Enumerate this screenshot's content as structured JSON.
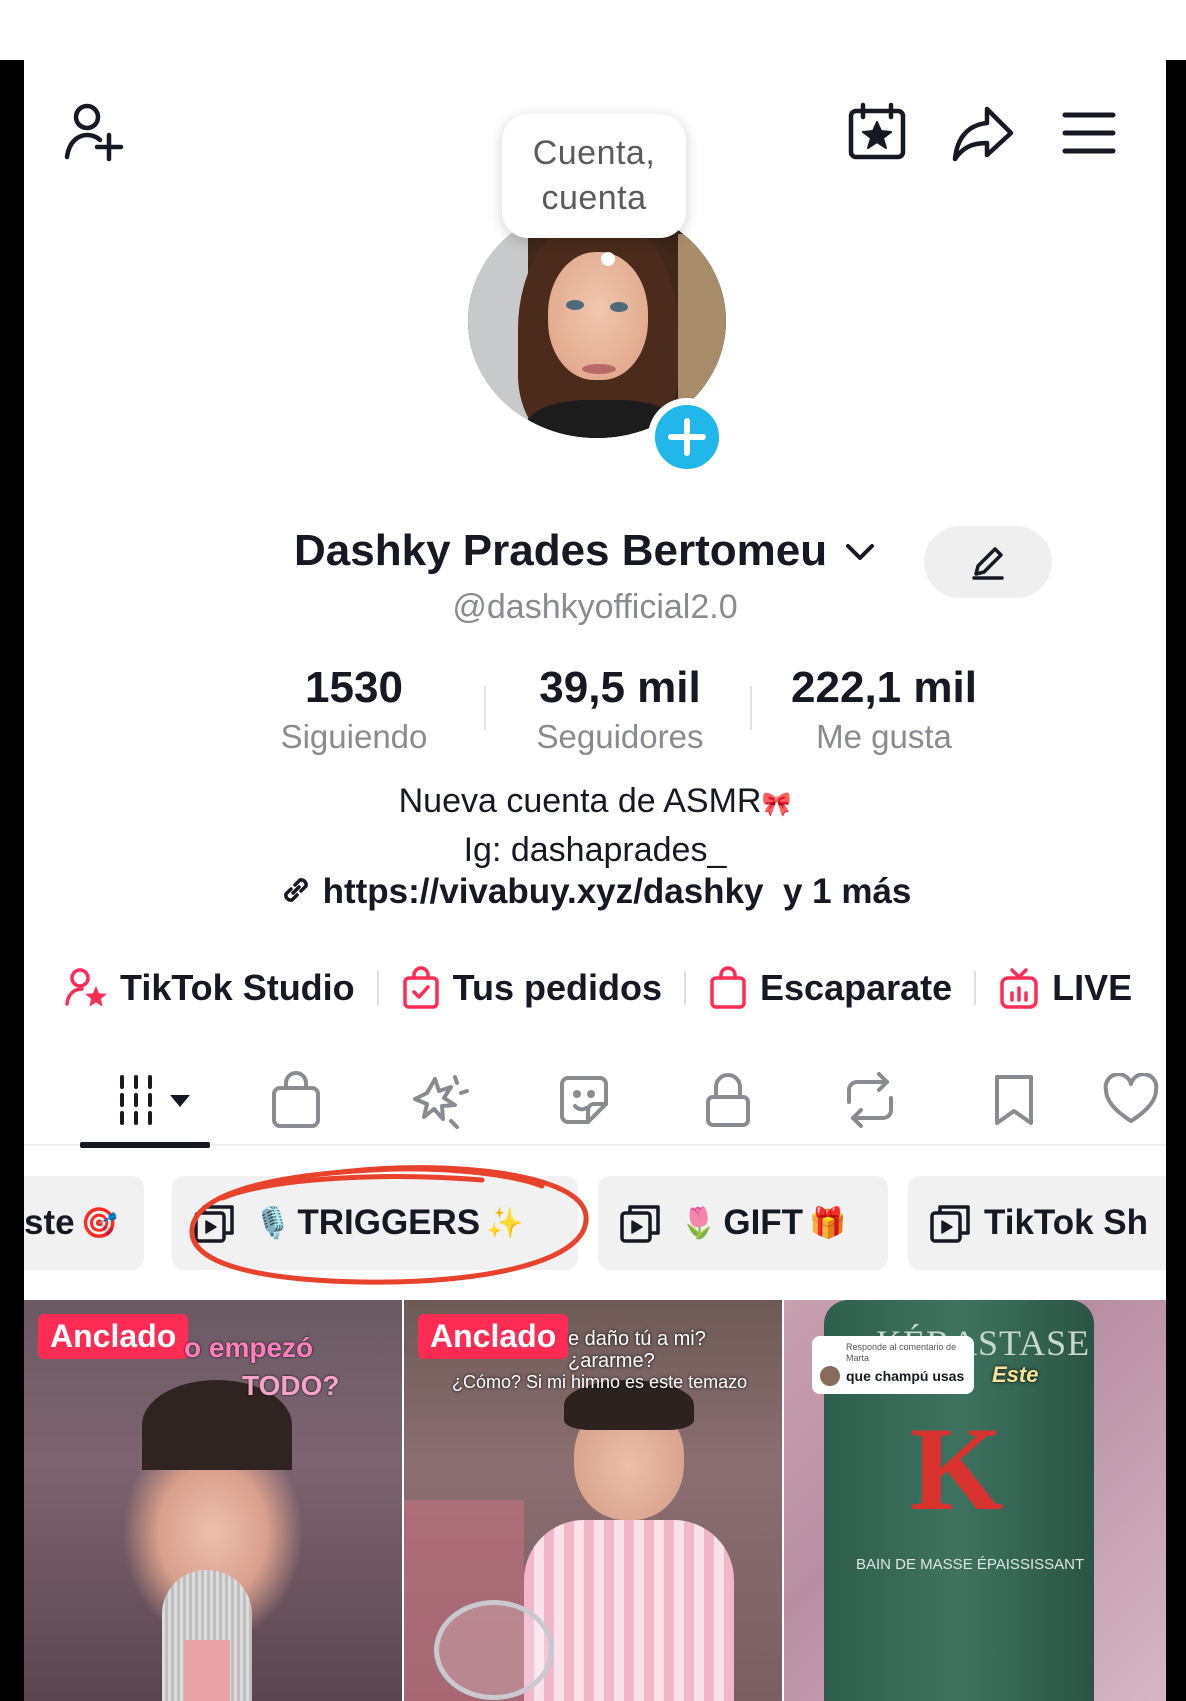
{
  "tooltip": {
    "line1": "Cuenta,",
    "line2": "cuenta"
  },
  "profile": {
    "display_name": "Dashky Prades Bertomeu",
    "handle": "@dashkyofficial2.0"
  },
  "stats": [
    {
      "value": "1530",
      "label": "Siguiendo"
    },
    {
      "value": "39,5 mil",
      "label": "Seguidores"
    },
    {
      "value": "222,1 mil",
      "label": "Me gusta"
    }
  ],
  "bio": {
    "line1": "Nueva cuenta de ASMR",
    "line1_emoji": "🎀",
    "line2": "Ig: dashaprades_",
    "link_text": "https://vivabuy.xyz/dashky",
    "link_more": "y 1 más"
  },
  "shortcuts": [
    {
      "label": "TikTok Studio",
      "icon": "studio-icon"
    },
    {
      "label": "Tus pedidos",
      "icon": "orders-bag-icon"
    },
    {
      "label": "Escaparate",
      "icon": "showcase-bag-icon"
    },
    {
      "label": "LIVE",
      "icon": "live-tv-icon"
    }
  ],
  "tabs": [
    {
      "name": "videos-grid-icon"
    },
    {
      "name": "shop-bag-icon"
    },
    {
      "name": "sparkle-effects-icon"
    },
    {
      "name": "sticker-icon"
    },
    {
      "name": "private-lock-icon"
    },
    {
      "name": "repost-icon"
    },
    {
      "name": "saved-bookmark-icon"
    },
    {
      "name": "liked-heart-icon"
    }
  ],
  "playlists": [
    {
      "label": "ste",
      "emoji_after": "🎯"
    },
    {
      "label": "TRIGGERS",
      "emoji_before": "🎙️",
      "emoji_after": "✨"
    },
    {
      "label": "GIFT",
      "emoji_before": "🌷",
      "emoji_after": "🎁"
    },
    {
      "label": "TikTok Sh"
    }
  ],
  "videos": [
    {
      "badge": "Anclado",
      "caption1": "o empezó",
      "caption2": "TODO?"
    },
    {
      "badge": "Anclado",
      "caption1": "e daño tú a mi?",
      "caption2": "¿ararme?",
      "caption3": "¿Cómo? Si mi himno es este temazo"
    },
    {
      "badge": "",
      "caption1": "Responde al comentario de Marta",
      "caption2": "que champú usas",
      "caption3": "Este",
      "product_brand": "KÉRASTASE",
      "product_text": "BAIN DE MASSE ÉPAISSISSANT"
    }
  ],
  "colors": {
    "accent": "#fe2c55",
    "plus_badge": "#22b7ea",
    "annotation_red": "#e8412c"
  }
}
